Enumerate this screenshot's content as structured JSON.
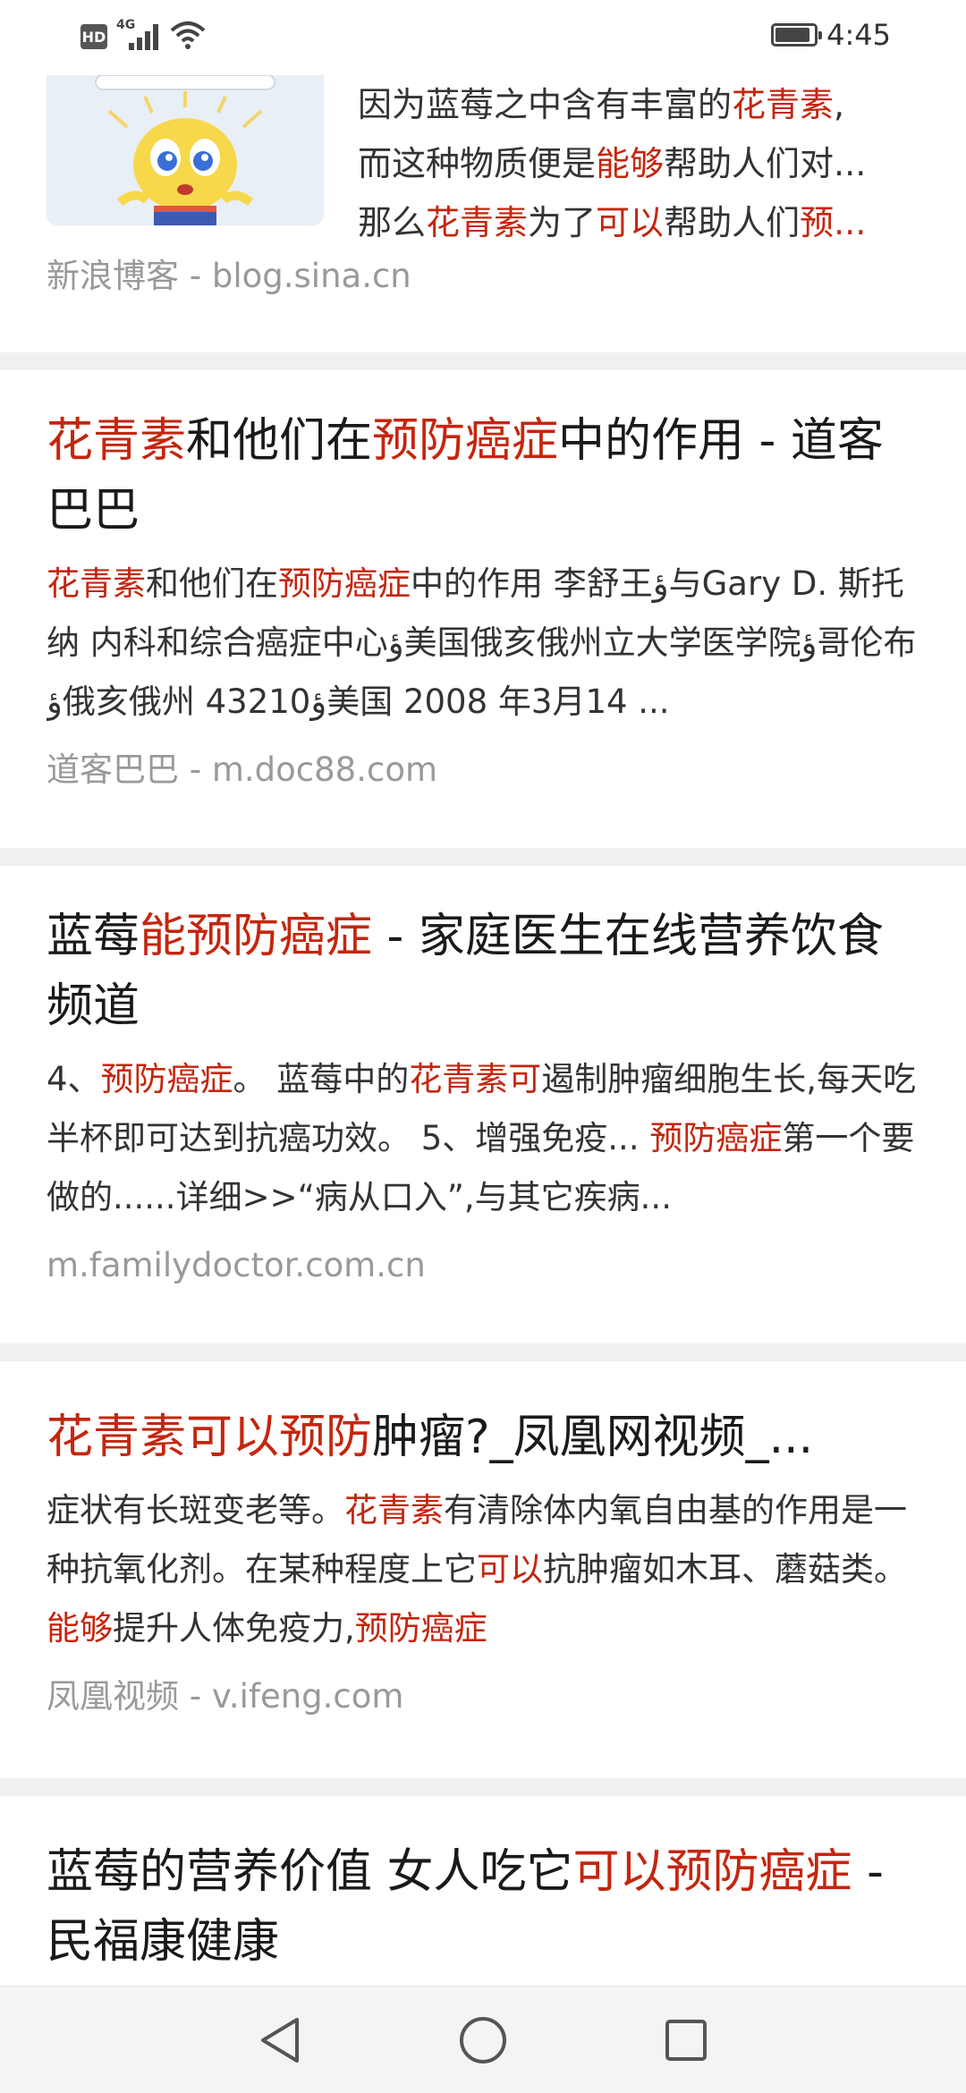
{
  "status_bar": {
    "hd_label": "HD",
    "network": "4G",
    "time": "4:45",
    "battery_level": 0.9
  },
  "results": [
    {
      "snippet_lines": [
        [
          {
            "t": "因为蓝莓之中含有丰富的",
            "h": false
          },
          {
            "t": "花青素",
            "h": true
          },
          {
            "t": ",",
            "h": false
          }
        ],
        [
          {
            "t": "而这种物质便是",
            "h": false
          },
          {
            "t": "能够",
            "h": true
          },
          {
            "t": "帮助人们对...",
            "h": false
          }
        ],
        [
          {
            "t": "那么",
            "h": false
          },
          {
            "t": "花青素",
            "h": true
          },
          {
            "t": "为了",
            "h": false
          },
          {
            "t": "可以",
            "h": true
          },
          {
            "t": "帮助人们",
            "h": false
          },
          {
            "t": "预...",
            "h": true
          }
        ]
      ],
      "source": "新浪博客 - blog.sina.cn",
      "thumbnail_icon": "cartoon-lightbulb-mascot"
    },
    {
      "title": [
        {
          "t": "花青素",
          "h": true
        },
        {
          "t": "和他们在",
          "h": false
        },
        {
          "t": "预防癌症",
          "h": true
        },
        {
          "t": "中的作用 - 道客巴巴",
          "h": false
        }
      ],
      "snippet": [
        {
          "t": "花青素",
          "h": true
        },
        {
          "t": "和他们在",
          "h": false
        },
        {
          "t": "预防癌症",
          "h": true
        },
        {
          "t": "中的作用 李舒王ؤ与Gary D. 斯托纳 内科和综合癌症中心ؤ美国俄亥俄州立大学医学院ؤ哥伦布ؤ俄亥俄州 43210ؤ美国 2008 年3月14 ...",
          "h": false
        }
      ],
      "source": "道客巴巴 - m.doc88.com"
    },
    {
      "title": [
        {
          "t": "蓝莓",
          "h": false
        },
        {
          "t": "能预防癌症",
          "h": true
        },
        {
          "t": " - 家庭医生在线营养饮食频道",
          "h": false
        }
      ],
      "snippet": [
        {
          "t": "4、",
          "h": false
        },
        {
          "t": "预防癌症",
          "h": true
        },
        {
          "t": "。 蓝莓中的",
          "h": false
        },
        {
          "t": "花青素可",
          "h": true
        },
        {
          "t": "遏制肿瘤细胞生长,每天吃半杯即可达到抗癌功效。 5、增强免疫... ",
          "h": false
        },
        {
          "t": "预防癌症",
          "h": true
        },
        {
          "t": "第一个要做的......详细>>“病从口入”,与其它疾病...",
          "h": false
        }
      ],
      "source": "m.familydoctor.com.cn"
    },
    {
      "title": [
        {
          "t": "花青素可以预防",
          "h": true
        },
        {
          "t": "肿瘤?_凤凰网视频_...",
          "h": false
        }
      ],
      "snippet": [
        {
          "t": "症状有长斑变老等。",
          "h": false
        },
        {
          "t": "花青素",
          "h": true
        },
        {
          "t": "有清除体内氧自由基的作用是一种抗氧化剂。在某种程度上它",
          "h": false
        },
        {
          "t": "可以",
          "h": true
        },
        {
          "t": "抗肿瘤如木耳、蘑菇类。",
          "h": false
        },
        {
          "t": "能够",
          "h": true
        },
        {
          "t": "提升人体免疫力,",
          "h": false
        },
        {
          "t": "预防癌症",
          "h": true
        }
      ],
      "source": "凤凰视频 - v.ifeng.com"
    },
    {
      "title": [
        {
          "t": "蓝莓的营养价值 女人吃它",
          "h": false
        },
        {
          "t": "可以预防癌症",
          "h": true
        },
        {
          "t": " - 民福康健康",
          "h": false
        }
      ]
    }
  ],
  "nav_bar": {
    "back_icon": "triangle-back-icon",
    "home_icon": "circle-home-icon",
    "recents_icon": "square-recents-icon"
  },
  "colors": {
    "highlight": "#c4260e",
    "title": "#1a1a1a",
    "snippet": "#333333",
    "source": "#999999",
    "divider": "#f0f0f0"
  }
}
